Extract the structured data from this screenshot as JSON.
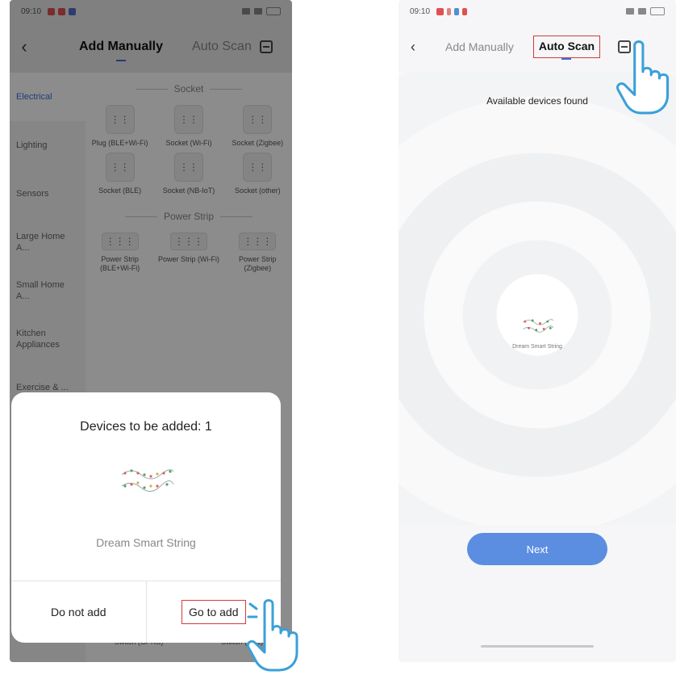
{
  "left": {
    "status": {
      "time": "09:10"
    },
    "header": {
      "tab_manual": "Add Manually",
      "tab_auto": "Auto Scan"
    },
    "categories": [
      "Electrical",
      "Lighting",
      "Sensors",
      "Large Home A...",
      "Small Home A...",
      "Kitchen Appliances",
      "Exercise & ..."
    ],
    "sections": [
      {
        "title": "Socket",
        "rows": [
          [
            "Plug (BLE+Wi-Fi)",
            "Socket (Wi-Fi)",
            "Socket (Zigbee)"
          ],
          [
            "Socket (BLE)",
            "Socket (NB-IoT)",
            "Socket (other)"
          ]
        ]
      },
      {
        "title": "Power Strip",
        "rows": [
          [
            "Power Strip (BLE+Wi-Fi)",
            "Power Strip (Wi-Fi)",
            "Power Strip (Zigbee)"
          ]
        ]
      }
    ],
    "peek": [
      "Switch (GPRS)",
      "Switch (BLE)"
    ],
    "sheet": {
      "title": "Devices to be added: 1",
      "device_name": "Dream Smart String",
      "btn_no": "Do not add",
      "btn_go": "Go to add"
    }
  },
  "right": {
    "status": {
      "time": "09:10"
    },
    "header": {
      "tab_manual": "Add Manually",
      "tab_auto": "Auto Scan"
    },
    "found_text": "Available devices found",
    "device_caption": "Dream Smart String",
    "next_label": "Next"
  },
  "colors": {
    "accent": "#3b6fd6",
    "highlight": "#d43a3a",
    "next": "#5b8ee0"
  },
  "icons": [
    "back-icon",
    "scan-icon",
    "socket-icon",
    "power-strip-icon",
    "hand-pointer-icon"
  ]
}
